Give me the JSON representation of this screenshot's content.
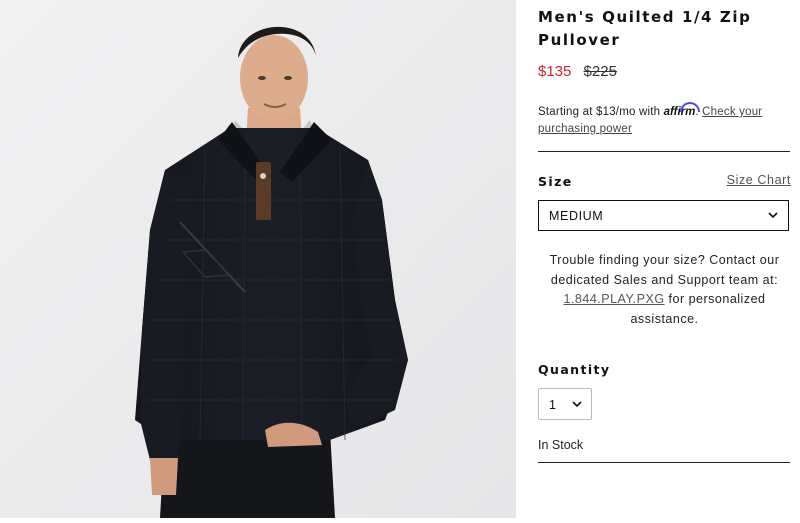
{
  "product": {
    "title": "Men's Quilted 1/4 Zip Pullover",
    "image_alt": "Model wearing black quilted quarter-zip pullover with brown placket"
  },
  "price": {
    "sale": "$135",
    "original": "$225",
    "sale_color": "#c8262b"
  },
  "affirm": {
    "prefix": "Starting at $13/mo with ",
    "logo": "affirm",
    "suffix": ". ",
    "link": "Check your purchasing power",
    "logo_color": "#4a4af4"
  },
  "size": {
    "label": "Size",
    "chart_link": "Size Chart",
    "selected": "MEDIUM"
  },
  "help": {
    "text_before": "Trouble finding your size? Contact our dedicated Sales and Support team at: ",
    "phone": "1.844.PLAY.PXG",
    "text_after": " for personalized assistance."
  },
  "quantity": {
    "label": "Quantity",
    "selected": "1"
  },
  "stock": {
    "status": "In Stock"
  },
  "icons": {
    "size_dropdown": "chevron-down-icon",
    "qty_dropdown": "chevron-down-icon"
  }
}
